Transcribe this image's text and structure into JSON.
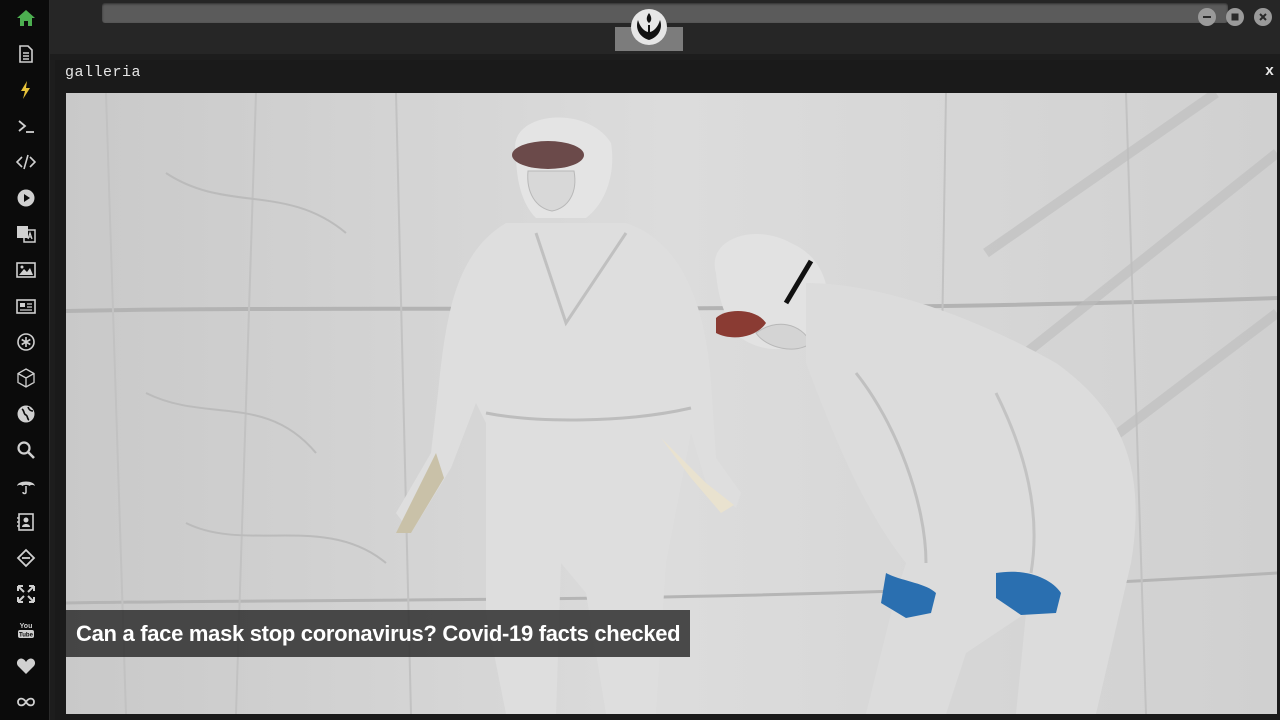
{
  "window": {
    "panel_title": "galleria",
    "close_label": "x"
  },
  "sidebar": {
    "items": [
      {
        "name": "home-icon",
        "color": "#4caf50"
      },
      {
        "name": "document-icon"
      },
      {
        "name": "lightning-icon",
        "color": "#e8c33a"
      },
      {
        "name": "terminal-icon",
        "text": ">_"
      },
      {
        "name": "code-icon"
      },
      {
        "name": "play-icon"
      },
      {
        "name": "translate-icon"
      },
      {
        "name": "image-icon"
      },
      {
        "name": "newspaper-icon"
      },
      {
        "name": "asterisk-icon"
      },
      {
        "name": "cube-icon"
      },
      {
        "name": "globe-icon"
      },
      {
        "name": "search-icon"
      },
      {
        "name": "umbrella-icon"
      },
      {
        "name": "contacts-icon"
      },
      {
        "name": "link-icon"
      },
      {
        "name": "expand-icon"
      },
      {
        "name": "youtube-icon",
        "text": "You Tube"
      },
      {
        "name": "heart-icon"
      },
      {
        "name": "infinity-icon"
      }
    ]
  },
  "gallery": {
    "caption": "Can a face mask stop coronavirus? Covid-19 facts checked"
  },
  "colors": {
    "accent_green": "#4caf50",
    "accent_yellow": "#e8c33a"
  }
}
